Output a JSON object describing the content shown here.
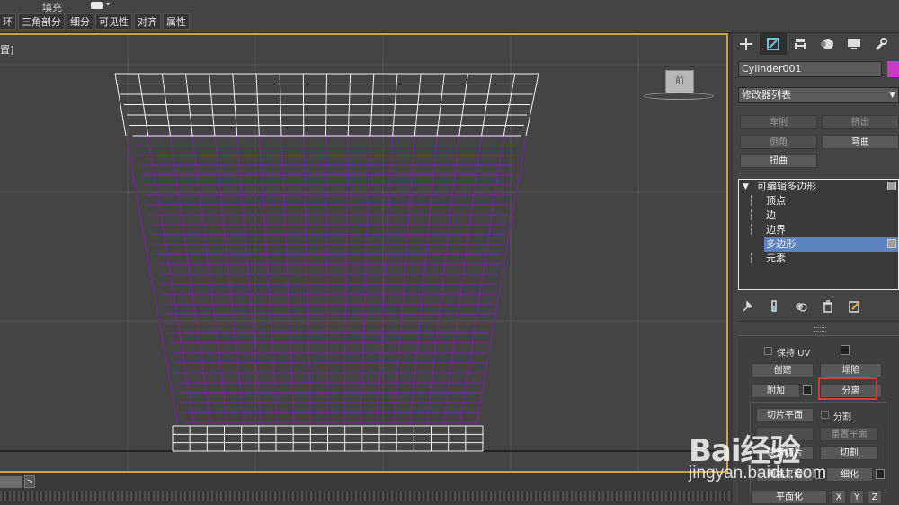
{
  "ribbon": {
    "fill_label": "填充",
    "tabs": [
      "环",
      "三角剖分",
      "细分",
      "可见性",
      "对齐",
      "属性"
    ]
  },
  "viewport": {
    "label": "置]",
    "viewcube_label": "前"
  },
  "timeline": {
    "next_label": ">"
  },
  "panel": {
    "object_name": "Cylinder001",
    "object_color": "#c83cc8",
    "modifier_list_label": "修改器列表",
    "quick_modifiers": [
      "车削",
      "挤出",
      "倒角",
      "弯曲",
      "扭曲"
    ],
    "stack": {
      "root": "可编辑多边形",
      "sub_objects": [
        "顶点",
        "边",
        "边界",
        "多边形",
        "元素"
      ],
      "selected": "多边形"
    },
    "edit_geometry": {
      "preserve_uv": "保持 UV",
      "create": "创建",
      "collapse": "塌陷",
      "attach": "附加",
      "detach": "分离",
      "slice_plane": "切片平面",
      "split": "分割",
      "reset_plane": "重置平面",
      "quick_slice": "快速切片",
      "cut": "切割",
      "msmooth": "网格平滑",
      "tessellate": "细化",
      "make_planar": "平面化",
      "x": "X",
      "y": "Y",
      "z": "Z"
    }
  },
  "watermark": {
    "logo": "Bai经验",
    "url": "jingyan.baidu.com"
  }
}
